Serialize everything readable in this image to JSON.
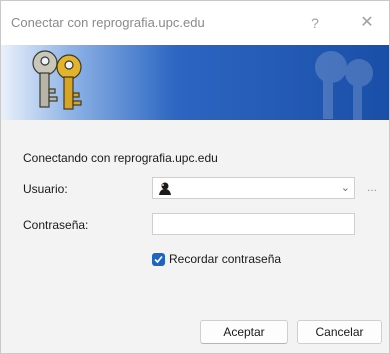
{
  "window": {
    "title": "Conectar con reprografia.upc.edu",
    "help_glyph": "?",
    "close_glyph": "✕"
  },
  "banner": {
    "background_color": "#1f5bb8",
    "icon": "keys-icon"
  },
  "main": {
    "connecting_text": "Conectando con reprografia.upc.edu"
  },
  "form": {
    "user_label": "Usuario:",
    "user_value": "",
    "user_dropdown_glyph": "⌄",
    "more_button_label": "...",
    "password_label": "Contraseña:",
    "password_value": "",
    "remember_label": "Recordar contraseña",
    "remember_checked": true
  },
  "buttons": {
    "ok_label": "Aceptar",
    "cancel_label": "Cancelar"
  },
  "colors": {
    "accent": "#1f64c0",
    "dialog_background": "#f3f3f3"
  }
}
